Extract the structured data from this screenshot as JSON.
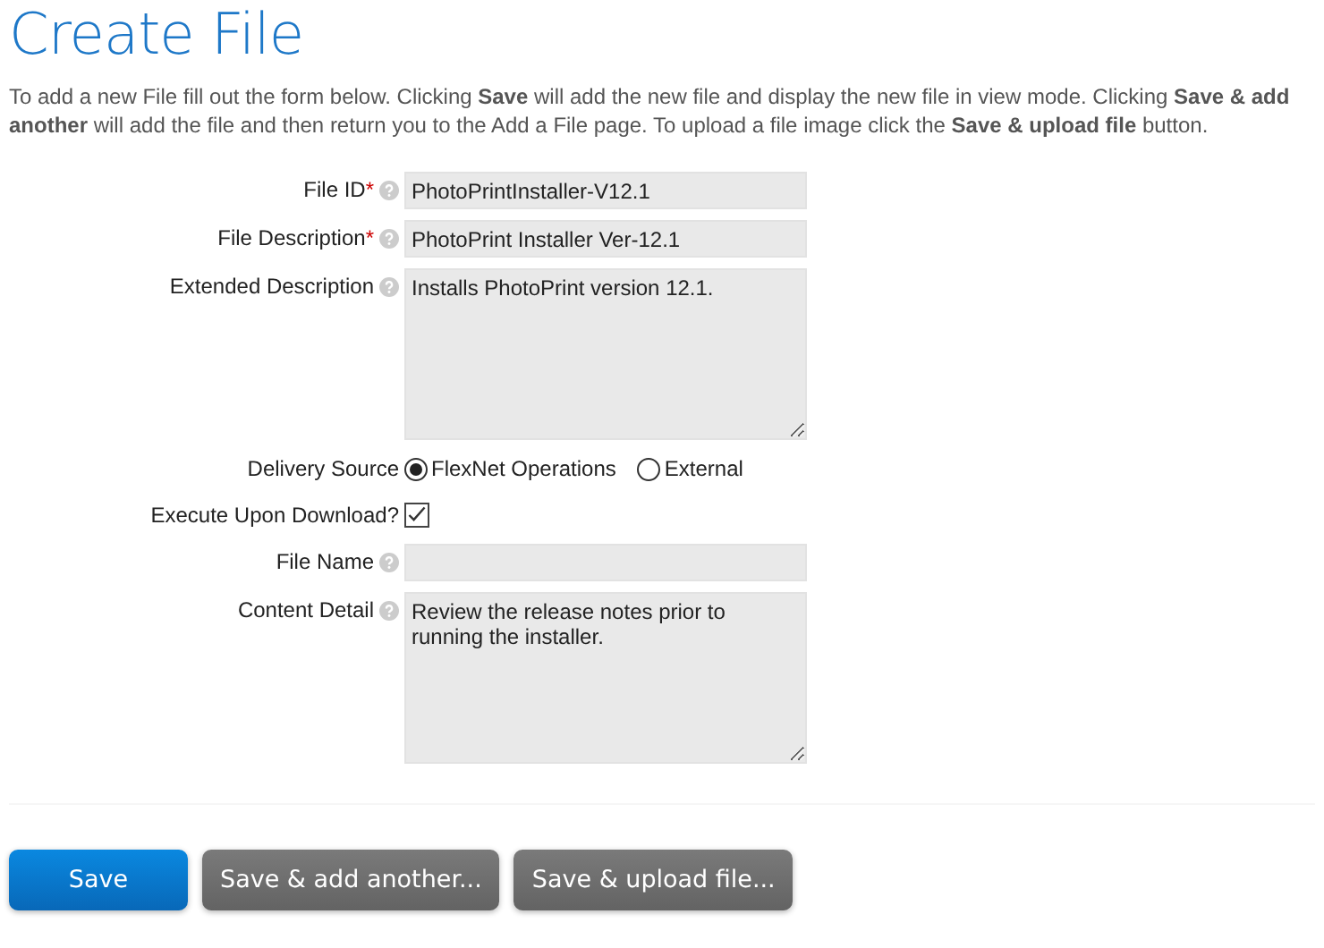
{
  "title": "Create File",
  "intro": "To add a new File fill out the form below. Clicking **Save** will add the new file and display the new file in view mode. Clicking **Save & add another** will add the file and then return you to the Add a File page. To upload a file image click the **Save & upload file** button.",
  "fields": [
    {
      "kind": "text",
      "label": "File ID",
      "required_mark": "*",
      "help": true,
      "value": "PhotoPrintInstaller-V12.1"
    },
    {
      "kind": "text",
      "label": "File Description",
      "required_mark": "*",
      "help": true,
      "value": "PhotoPrint Installer Ver-12.1"
    },
    {
      "kind": "textarea",
      "label": "Extended Description",
      "help": true,
      "value": "Installs PhotoPrint version 12.1."
    },
    {
      "kind": "radio",
      "label": "Delivery Source",
      "help": false,
      "options": [
        {
          "label": "FlexNet Operations",
          "selected": true
        },
        {
          "label": "External",
          "selected": false
        }
      ]
    },
    {
      "kind": "checkbox",
      "label": "Execute Upon Download?",
      "help": false,
      "checked": true
    },
    {
      "kind": "text",
      "label": "File Name",
      "help": true
    },
    {
      "kind": "textarea",
      "label": "Content Detail",
      "help": true,
      "value": "Review the release notes prior to running the installer."
    }
  ],
  "buttons": [
    {
      "label": "Save",
      "kind": "primary"
    },
    {
      "label": "Save & add another...",
      "kind": "secondary"
    },
    {
      "label": "Save & upload file...",
      "kind": "secondary"
    }
  ]
}
